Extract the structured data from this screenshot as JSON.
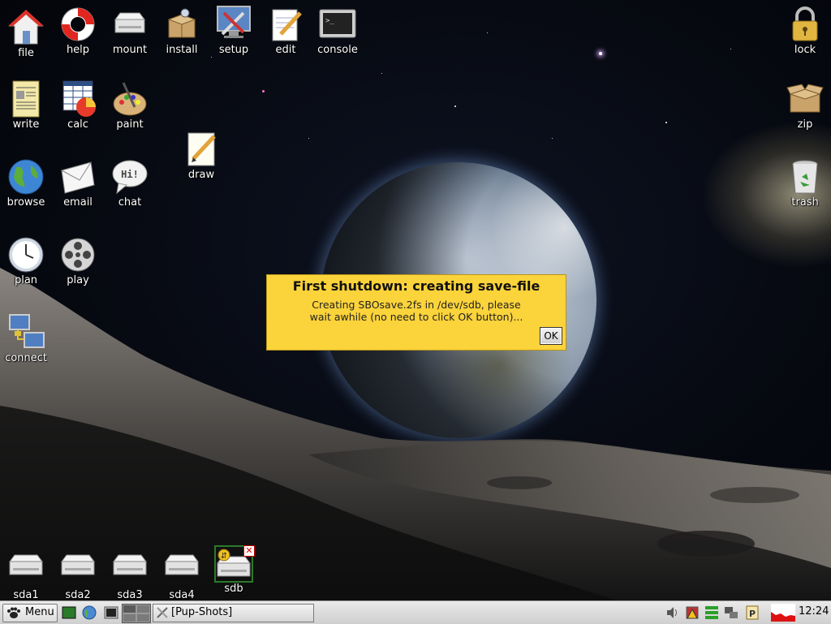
{
  "desktop_icons": [
    {
      "label": "file"
    },
    {
      "label": "help"
    },
    {
      "label": "mount"
    },
    {
      "label": "install"
    },
    {
      "label": "setup"
    },
    {
      "label": "edit"
    },
    {
      "label": "console"
    },
    {
      "label": "write"
    },
    {
      "label": "calc"
    },
    {
      "label": "paint"
    },
    {
      "label": "draw"
    },
    {
      "label": "browse"
    },
    {
      "label": "email"
    },
    {
      "label": "chat"
    },
    {
      "label": "plan"
    },
    {
      "label": "play"
    },
    {
      "label": "connect"
    },
    {
      "label": "lock"
    },
    {
      "label": "zip"
    },
    {
      "label": "trash"
    }
  ],
  "drive_icons": [
    {
      "label": "sda1"
    },
    {
      "label": "sda2"
    },
    {
      "label": "sda3"
    },
    {
      "label": "sda4"
    },
    {
      "label": "sdb"
    }
  ],
  "dialog": {
    "title": "First shutdown: creating save-file",
    "message_line1": "Creating SBOsave.2fs in /dev/sdb, please",
    "message_line2": "wait awhile (no need to click OK button)...",
    "ok_label": "OK",
    "background": "#fbd33a"
  },
  "taskbar": {
    "menu_label": "Menu",
    "task_label": "[Pup-Shots]",
    "clock": "12:24"
  },
  "chat_bubble_text": "Hi!"
}
